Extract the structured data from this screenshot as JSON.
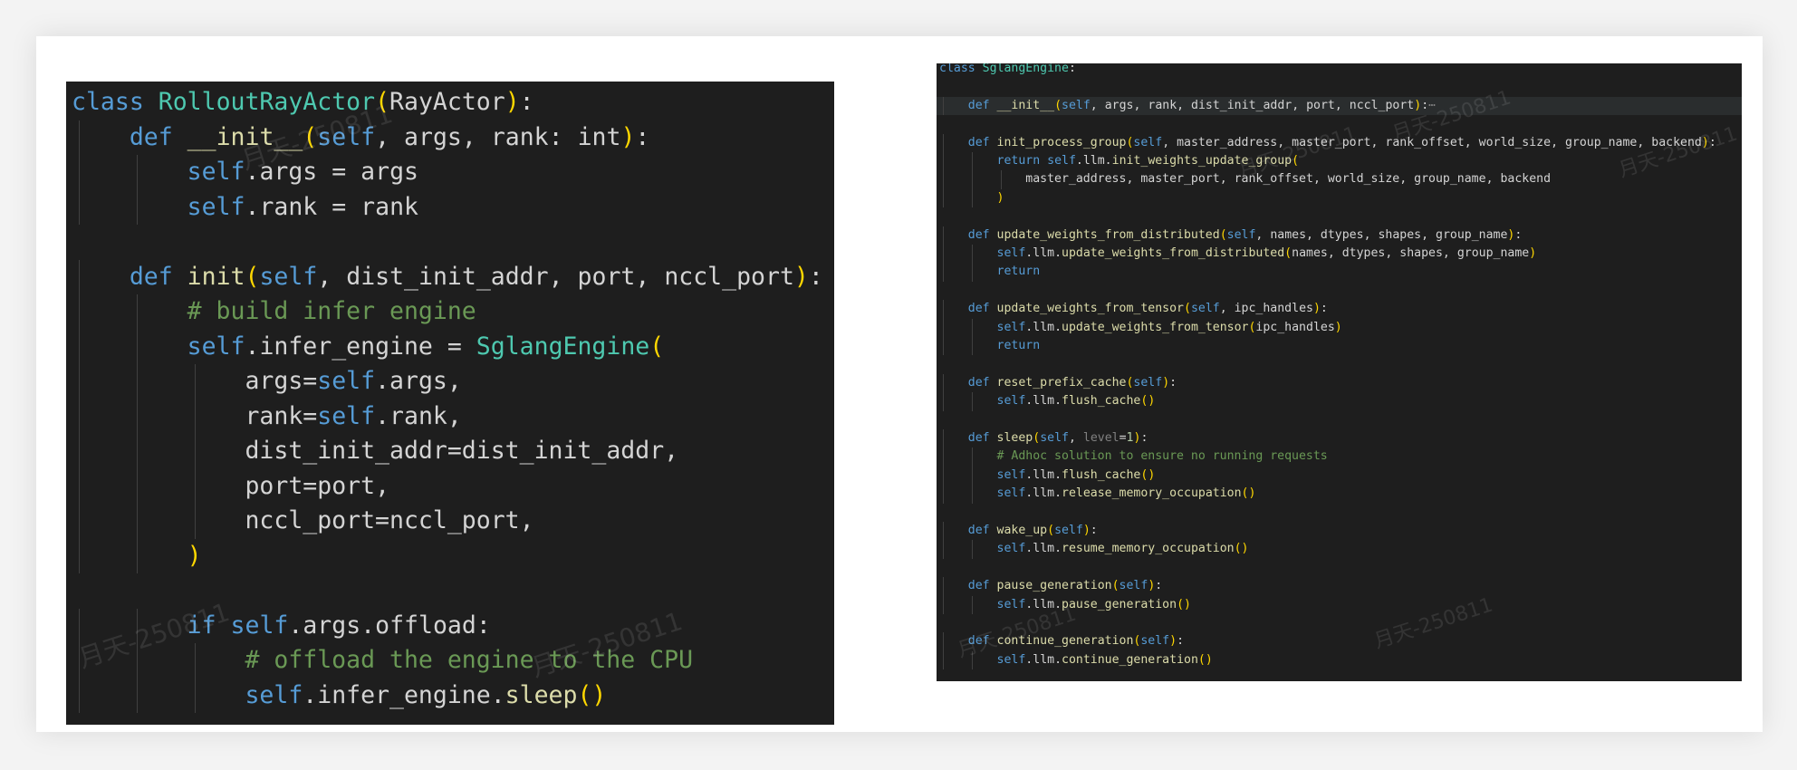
{
  "left_editor": {
    "lines": [
      "class RolloutRayActor(RayActor):",
      "    def __init__(self, args, rank: int):",
      "        self.args = args",
      "        self.rank = rank",
      "",
      "    def init(self, dist_init_addr, port, nccl_port):",
      "        # build infer engine",
      "        self.infer_engine = SglangEngine(",
      "            args=self.args,",
      "            rank=self.rank,",
      "            dist_init_addr=dist_init_addr,",
      "            port=port,",
      "            nccl_port=nccl_port,",
      "        )",
      "",
      "        if self.args.offload:",
      "            # offload the engine to the CPU",
      "            self.infer_engine.sleep()"
    ]
  },
  "right_editor": {
    "lines": [
      "class SglangEngine:",
      "",
      "    def __init__(self, args, rank, dist_init_addr, port, nccl_port):⋯",
      "",
      "    def init_process_group(self, master_address, master_port, rank_offset, world_size, group_name, backend):",
      "        return self.llm.init_weights_update_group(",
      "            master_address, master_port, rank_offset, world_size, group_name, backend",
      "        )",
      "",
      "    def update_weights_from_distributed(self, names, dtypes, shapes, group_name):",
      "        self.llm.update_weights_from_distributed(names, dtypes, shapes, group_name)",
      "        return",
      "",
      "    def update_weights_from_tensor(self, ipc_handles):",
      "        self.llm.update_weights_from_tensor(ipc_handles)",
      "        return",
      "",
      "    def reset_prefix_cache(self):",
      "        self.llm.flush_cache()",
      "",
      "    def sleep(self, level=1):",
      "        # Adhoc solution to ensure no running requests",
      "        self.llm.flush_cache()",
      "        self.llm.release_memory_occupation()",
      "",
      "    def wake_up(self):",
      "        self.llm.resume_memory_occupation()",
      "",
      "    def pause_generation(self):",
      "        self.llm.pause_generation()",
      "",
      "    def continue_generation(self):",
      "        self.llm.continue_generation()"
    ]
  },
  "watermark": "月天-250811",
  "colors": {
    "editor_bg": "#1e1e1e",
    "keyword": "#569cd6",
    "function": "#dcdcaa",
    "class": "#4ec9b0",
    "comment": "#6a9955",
    "bracket": "#ffd700",
    "text": "#d4d4d4"
  }
}
